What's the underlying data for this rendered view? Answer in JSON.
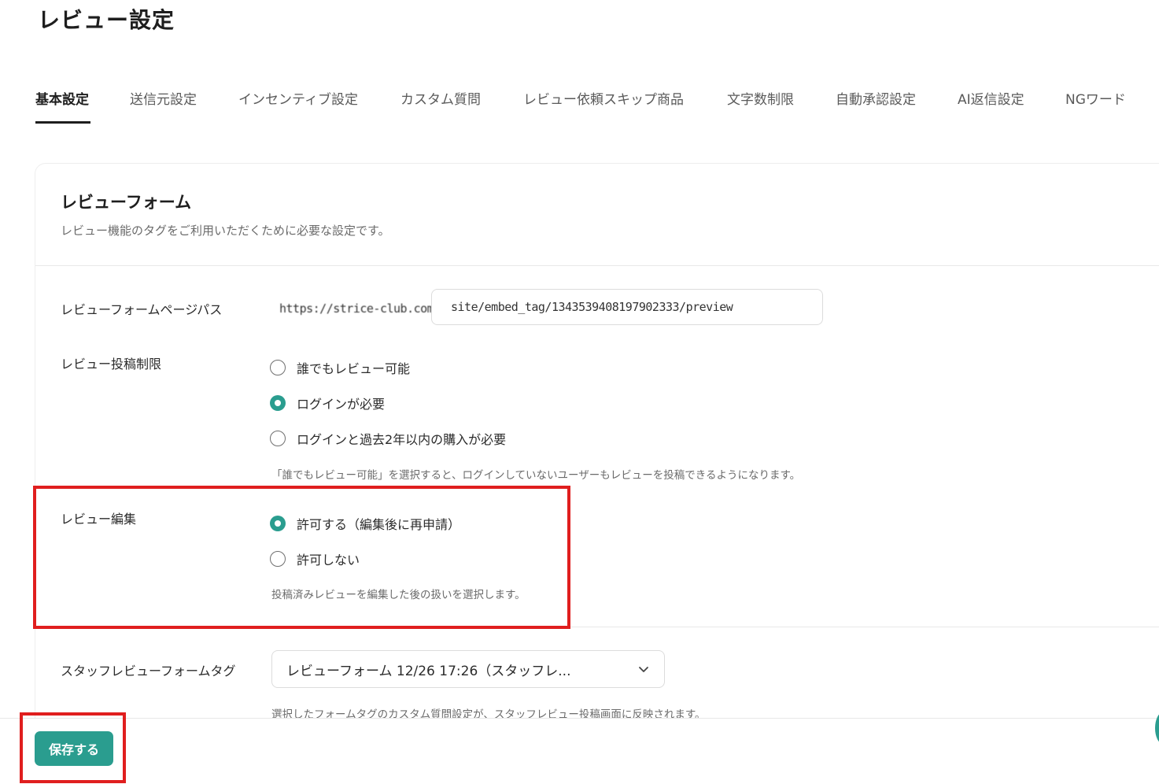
{
  "page": {
    "title": "レビュー設定"
  },
  "tabs": [
    {
      "label": "基本設定",
      "active": true
    },
    {
      "label": "送信元設定"
    },
    {
      "label": "インセンティブ設定"
    },
    {
      "label": "カスタム質問"
    },
    {
      "label": "レビュー依頼スキップ商品"
    },
    {
      "label": "文字数制限"
    },
    {
      "label": "自動承認設定"
    },
    {
      "label": "AI返信設定"
    },
    {
      "label": "NGワード"
    }
  ],
  "form": {
    "title": "レビューフォーム",
    "description": "レビュー機能のタグをご利用いただくために必要な設定です。",
    "page_path": {
      "label": "レビューフォームページパス",
      "prefix": "https://strice-club.com/",
      "value": "site/embed_tag/13435394081979023​33/preview"
    },
    "post_restriction": {
      "label": "レビュー投稿制限",
      "options": [
        {
          "label": "誰でもレビュー可能",
          "checked": false
        },
        {
          "label": "ログインが必要",
          "checked": true
        },
        {
          "label": "ログインと過去2年以内の購入が必要",
          "checked": false
        }
      ],
      "help": "「誰でもレビュー可能」を選択すると、ログインしていないユーザーもレビューを投稿できるようになります。"
    },
    "review_edit": {
      "label": "レビュー編集",
      "options": [
        {
          "label": "許可する（編集後に再申請）",
          "checked": true
        },
        {
          "label": "許可しない",
          "checked": false
        }
      ],
      "help": "投稿済みレビューを編集した後の扱いを選択します。"
    },
    "staff_tag": {
      "label": "スタッフレビューフォームタグ",
      "selected": "レビューフォーム 12/26 17:26（スタッフレ...",
      "help": "選択したフォームタグのカスタム質問設定が、スタッフレビュー投稿画面に反映されます。"
    }
  },
  "footer": {
    "save_label": "保存する"
  },
  "colors": {
    "accent": "#2a9d8f",
    "annotation": "#e01e1e"
  }
}
